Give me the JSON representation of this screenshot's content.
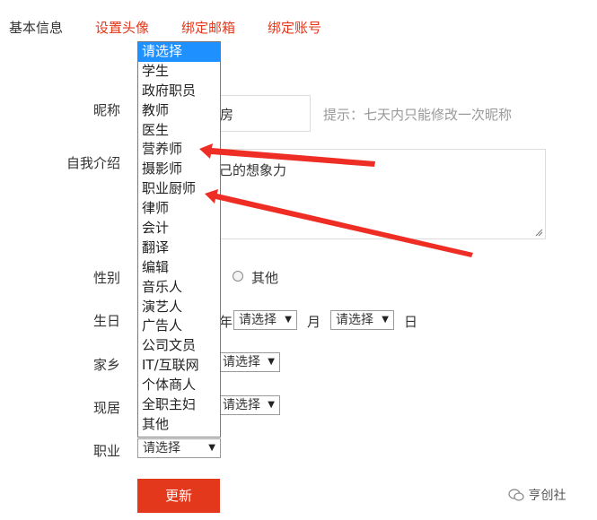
{
  "tabs": [
    {
      "label": "基本信息",
      "active": true
    },
    {
      "label": "设置头像",
      "active": false
    },
    {
      "label": "绑定邮箱",
      "active": false
    },
    {
      "label": "绑定账号",
      "active": false
    }
  ],
  "form": {
    "nickname_label": "昵称",
    "nickname_value": "房",
    "nickname_hint": "提示：七天内只能修改一次昵称",
    "intro_label": "自我介绍",
    "intro_value": "己的想象力",
    "gender_label": "性别",
    "gender_other": "其他",
    "birthday_label": "生日",
    "birthday_year_suffix": "年",
    "birthday_month_select": "请选择",
    "birthday_month_unit": "月",
    "birthday_day_select": "请选择",
    "birthday_day_unit": "日",
    "hometown_label": "家乡",
    "hometown_select": "请选择",
    "residence_label": "现居",
    "residence_select": "请选择",
    "job_label": "职业",
    "job_select": "请选择",
    "submit_label": "更新"
  },
  "job_options": [
    "请选择",
    "学生",
    "政府职员",
    "教师",
    "医生",
    "营养师",
    "摄影师",
    "职业厨师",
    "律师",
    "会计",
    "翻译",
    "编辑",
    "音乐人",
    "演艺人",
    "广告人",
    "公司文员",
    "IT/互联网",
    "个体商人",
    "全职主妇",
    "其他"
  ],
  "job_selected_index": 0,
  "watermark": "亨创社",
  "colors": {
    "accent": "#e3381b",
    "selection": "#1e90ff",
    "hint": "#999999"
  },
  "icons": {
    "wechat": "wechat-icon"
  }
}
